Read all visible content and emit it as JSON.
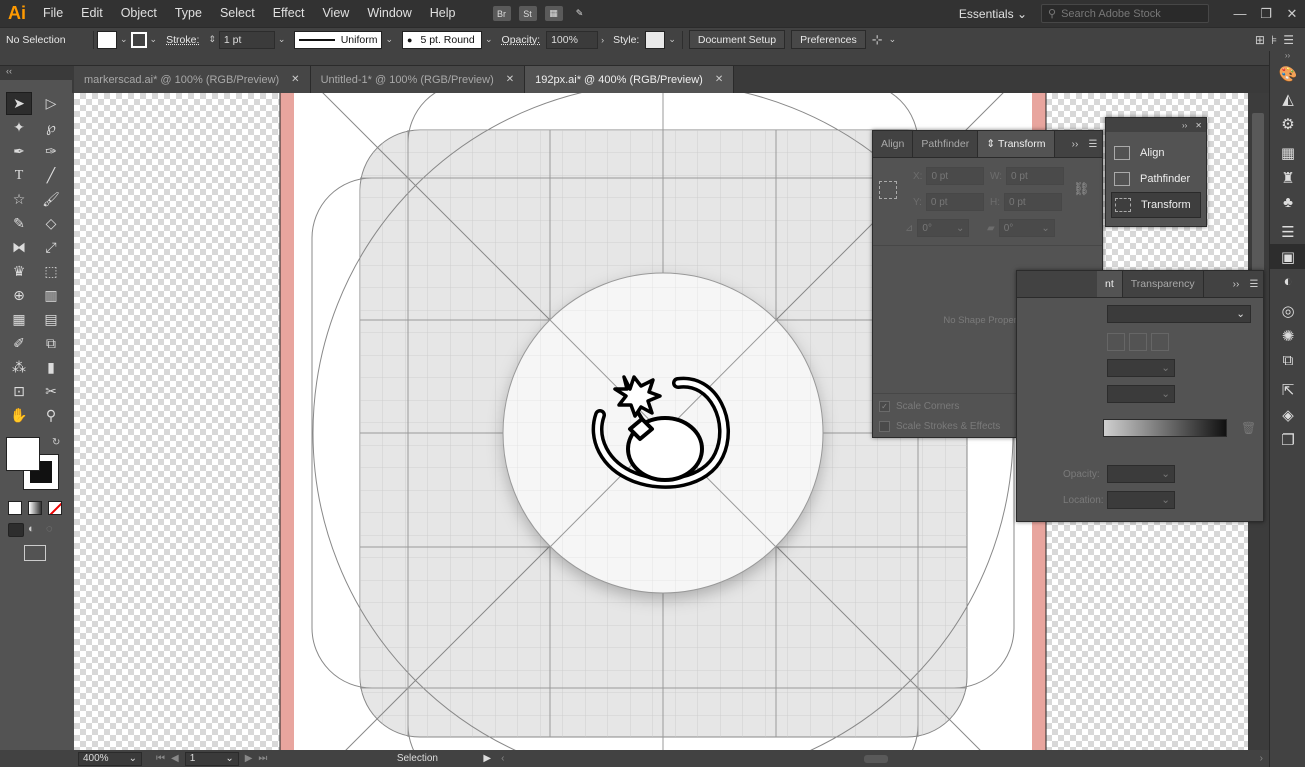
{
  "app": {
    "logo": "Ai"
  },
  "menu": [
    "File",
    "Edit",
    "Object",
    "Type",
    "Select",
    "Effect",
    "View",
    "Window",
    "Help"
  ],
  "menubar_icons": [
    "Br",
    "St"
  ],
  "workspace": "Essentials",
  "search_stock": {
    "placeholder": "Search Adobe Stock"
  },
  "control": {
    "selection": "No Selection",
    "stroke_label": "Stroke:",
    "stroke_weight": "1 pt",
    "profile": "Uniform",
    "brush": "5 pt. Round",
    "opacity_label": "Opacity:",
    "opacity_value": "100%",
    "style_label": "Style:",
    "document_setup": "Document Setup",
    "preferences": "Preferences"
  },
  "tabs": [
    {
      "label": "markerscad.ai* @ 100% (RGB/Preview)",
      "active": false
    },
    {
      "label": "Untitled-1* @ 100% (RGB/Preview)",
      "active": false
    },
    {
      "label": "192px.ai* @ 400% (RGB/Preview)",
      "active": true
    }
  ],
  "transform_panel": {
    "tabs": [
      "Align",
      "Pathfinder",
      "Transform"
    ],
    "x_label": "X:",
    "x_value": "0 pt",
    "y_label": "Y:",
    "y_value": "0 pt",
    "w_label": "W:",
    "w_value": "0 pt",
    "h_label": "H:",
    "h_value": "0 pt",
    "rotate_value": "0°",
    "shear_value": "0°",
    "no_shape": "No Shape Properties",
    "scale_corners": "Scale Corners",
    "scale_strokes": "Scale Strokes & Effects"
  },
  "mini_panel": {
    "items": [
      "Align",
      "Pathfinder",
      "Transform"
    ]
  },
  "gradient_panel": {
    "tabs": [
      "nt",
      "Transparency"
    ],
    "opacity_label": "Opacity:",
    "location_label": "Location:"
  },
  "status": {
    "zoom": "400%",
    "artboard": "1",
    "tool": "Selection"
  },
  "colors": {
    "bleed": "#e8a59e",
    "accent": "#ff9a00"
  }
}
